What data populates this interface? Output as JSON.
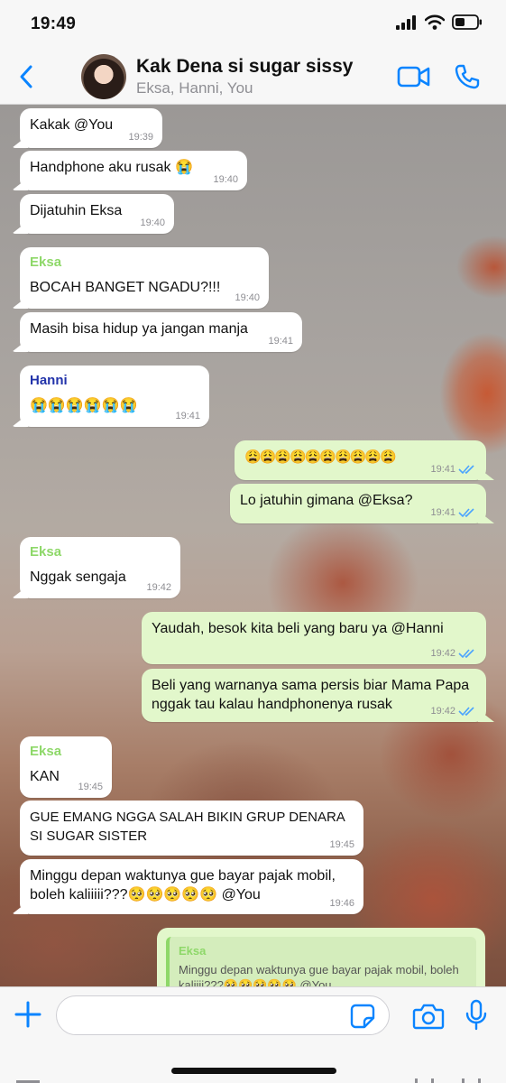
{
  "status_bar": {
    "time": "19:49"
  },
  "header": {
    "title": "Kak Dena si sugar sissy",
    "subtitle": "Eksa, Hanni, You"
  },
  "colors": {
    "accent": "#0a84ff",
    "incoming_bubble": "#ffffff",
    "outgoing_bubble": "#e2f7cb",
    "sender_eksa": "#8ed869",
    "sender_hanni": "#2233aa",
    "read_ticks": "#4aa3ff"
  },
  "messages": [
    {
      "direction": "in",
      "text": "Kakak @You",
      "time": "19:39"
    },
    {
      "direction": "in",
      "text": "Handphone aku rusak 😭",
      "time": "19:40"
    },
    {
      "direction": "in",
      "text": "Dijatuhin Eksa",
      "time": "19:40"
    },
    {
      "direction": "in",
      "sender": "Eksa",
      "text": "BOCAH BANGET NGADU?!!!",
      "time": "19:40"
    },
    {
      "direction": "in",
      "text": "Masih bisa hidup ya jangan manja",
      "time": "19:41"
    },
    {
      "direction": "in",
      "sender": "Hanni",
      "text": "😭😭😭😭😭😭",
      "time": "19:41"
    },
    {
      "direction": "out",
      "text": "😩😩😩😩😩😩😩😩😩😩",
      "time": "19:41"
    },
    {
      "direction": "out",
      "text": "Lo jatuhin gimana @Eksa?",
      "time": "19:41"
    },
    {
      "direction": "in",
      "sender": "Eksa",
      "text": "Nggak sengaja",
      "time": "19:42"
    },
    {
      "direction": "out",
      "text": "Yaudah, besok kita beli yang baru ya @Hanni",
      "time": "19:42"
    },
    {
      "direction": "out",
      "text": "Beli yang warnanya sama persis biar Mama Papa\nnggak tau kalau handphonenya rusak",
      "time": "19:42"
    },
    {
      "direction": "in",
      "sender": "Eksa",
      "text": "KAN",
      "time": "19:45"
    },
    {
      "direction": "in",
      "text": "GUE EMANG NGGA SALAH BIKIN GRUP DENARA\nSI SUGAR SISTER",
      "time": "19:45"
    },
    {
      "direction": "in",
      "text": "Minggu depan waktunya gue bayar pajak mobil,\nboleh kaliiiii???🥺🥺🥺🥺🥺 @You",
      "time": "19:46"
    }
  ],
  "quoted_reply": {
    "sender": "Eksa",
    "text": "Minggu depan waktunya gue bayar pajak mobil, boleh kaliiii???🥺🥺🥺🥺🥺 @You"
  },
  "input": {
    "placeholder": ""
  }
}
